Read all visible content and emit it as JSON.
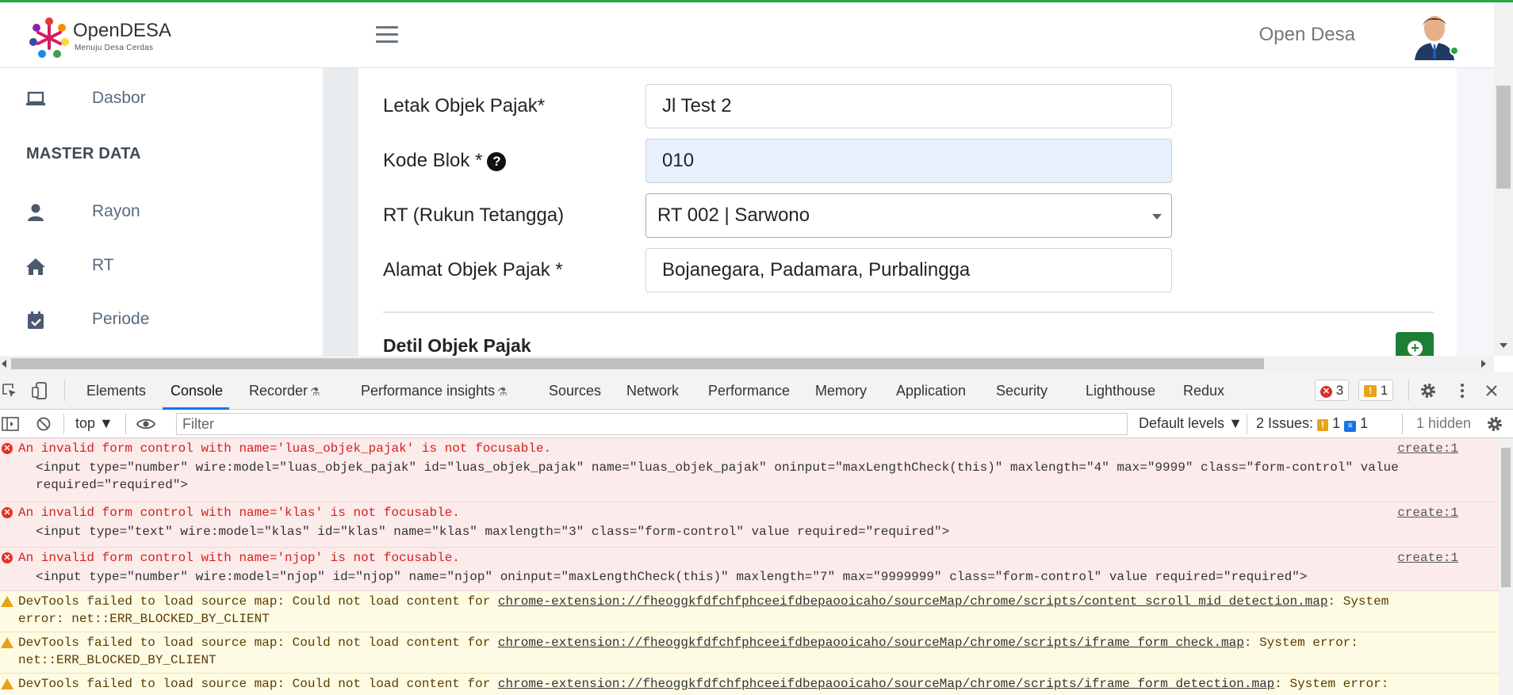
{
  "header": {
    "logo_title": "OpenDESA",
    "logo_subtitle": "Menuju Desa Cerdas",
    "user_name": "Open Desa"
  },
  "sidebar": {
    "items": [
      {
        "label": "Dasbor",
        "icon": "laptop-icon"
      },
      {
        "label": "Rayon",
        "icon": "user-icon"
      },
      {
        "label": "RT",
        "icon": "home-icon"
      },
      {
        "label": "Periode",
        "icon": "calendar-check-icon"
      }
    ],
    "section_heading": "MASTER DATA"
  },
  "form": {
    "letak_label": "Letak Objek Pajak*",
    "letak_value": "Jl Test 2",
    "kode_blok_label": "Kode Blok *",
    "kode_blok_help": "?",
    "kode_blok_value": "010",
    "rt_label": "RT (Rukun Tetangga)",
    "rt_value": "RT 002 | Sarwono",
    "alamat_label": "Alamat Objek Pajak *",
    "alamat_value": "Bojanegara, Padamara, Purbalingga",
    "section_title": "Detil Objek Pajak",
    "add_symbol": "+"
  },
  "devtools": {
    "tabs": [
      "Elements",
      "Console",
      "Recorder",
      "Performance insights",
      "Sources",
      "Network",
      "Performance",
      "Memory",
      "Application",
      "Security",
      "Lighthouse",
      "Redux"
    ],
    "active_tab": "Console",
    "error_count": "3",
    "warning_count": "1",
    "toolbar": {
      "context": "top",
      "filter_placeholder": "Filter",
      "levels": "Default levels",
      "issues_label": "2 Issues:",
      "issues_warn": "1",
      "issues_info": "1",
      "hidden": "1 hidden"
    },
    "messages": [
      {
        "level": "error",
        "line1": "An invalid form control with name='luas_objek_pajak' is not focusable.",
        "line2": "<input type=\"number\" wire:model=\"luas_objek_pajak\" id=\"luas_objek_pajak\" name=\"luas_objek_pajak\" oninput=\"maxLengthCheck(this)\" maxlength=\"4\" max=\"9999\" class=\"form-control\" value",
        "line3": "required=\"required\">",
        "source": "create:1"
      },
      {
        "level": "error",
        "line1": "An invalid form control with name='klas' is not focusable.",
        "line2": "<input type=\"text\" wire:model=\"klas\" id=\"klas\" name=\"klas\" maxlength=\"3\" class=\"form-control\" value required=\"required\">",
        "source": "create:1"
      },
      {
        "level": "error",
        "line1": "An invalid form control with name='njop' is not focusable.",
        "line2": "<input type=\"number\" wire:model=\"njop\" id=\"njop\" name=\"njop\" oninput=\"maxLengthCheck(this)\" maxlength=\"7\" max=\"9999999\" class=\"form-control\" value required=\"required\">",
        "source": "create:1"
      },
      {
        "level": "warning",
        "prefix": "DevTools failed to load source map: Could not load content for ",
        "link": "chrome-extension://fheoggkfdfchfphceeifdbepaooicaho/sourceMap/chrome/scripts/content_scroll_mid_detection.map",
        "suffix": ": System",
        "line2": "error: net::ERR_BLOCKED_BY_CLIENT"
      },
      {
        "level": "warning",
        "prefix": "DevTools failed to load source map: Could not load content for ",
        "link": "chrome-extension://fheoggkfdfchfphceeifdbepaooicaho/sourceMap/chrome/scripts/iframe_form_check.map",
        "suffix": ": System error:",
        "line2": "net::ERR_BLOCKED_BY_CLIENT"
      },
      {
        "level": "warning",
        "prefix": "DevTools failed to load source map: Could not load content for ",
        "link": "chrome-extension://fheoggkfdfchfphceeifdbepaooicaho/sourceMap/chrome/scripts/iframe_form_detection.map",
        "suffix": ": System error:"
      }
    ]
  },
  "colors": {
    "accent_green": "#1e7e34",
    "error_red": "#d7201b",
    "warning_amber": "#e8a317",
    "devtools_blue": "#1a73e8"
  }
}
